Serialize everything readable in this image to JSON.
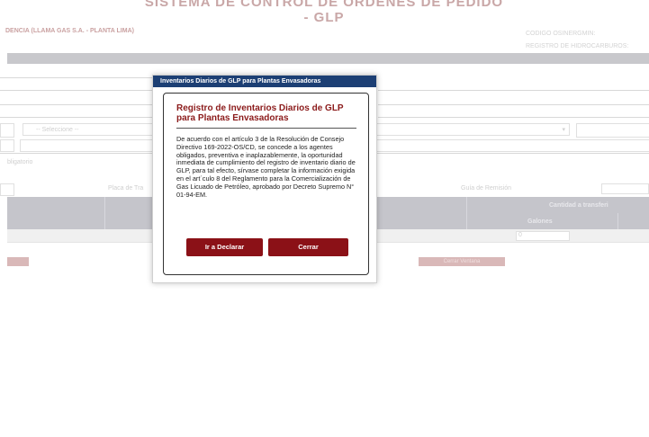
{
  "background": {
    "system_title": "SISTEMA DE CONTROL DE ORDENES DE PEDIDO - GLP",
    "company": "DENCIA (LLAMA GAS S.A. - PLANTA LIMA)",
    "code_line1": "CODIGO OSINERGMIN:",
    "code_line2": "REGISTRO DE HIDROCARBUROS:",
    "select_placeholder": "-- Seleccione --",
    "required_note": "bligatorio",
    "placa_label": "Placa de Tra",
    "guia_label": "Guía de Remisión",
    "cantidad_header": "Cantidad a transferi",
    "galones_header": "Galones",
    "galones_value": "0",
    "cerrar_ventana": "Cerrar Ventana"
  },
  "dialog": {
    "titlebar": "Inventarios Diarios de GLP para Plantas Envasadoras",
    "title": "Registro de Inventarios Diarios de GLP para Plantas Envasadoras",
    "body": "De acuerdo con el artículo 3 de la Resolución de Consejo Directivo 169-2022-OS/CD, se concede a los agentes obligados, preventiva e inaplazablemente, la oportunidad inmediata de cumplimiento del registro de inventario diario de GLP, para tal efecto, sírvase completar la información exigida en el art´culo 8 del Reglamento para la Comercialización de Gas Licuado de Petróleo, aprobado por Decreto Supremo N° 01-94-EM.",
    "btn_declarar": "Ir a Declarar",
    "btn_cerrar": "Cerrar"
  },
  "colors": {
    "titlebar": "#1c3f74",
    "accent_button": "#8b1117",
    "panel_title": "#8b1a1a"
  }
}
